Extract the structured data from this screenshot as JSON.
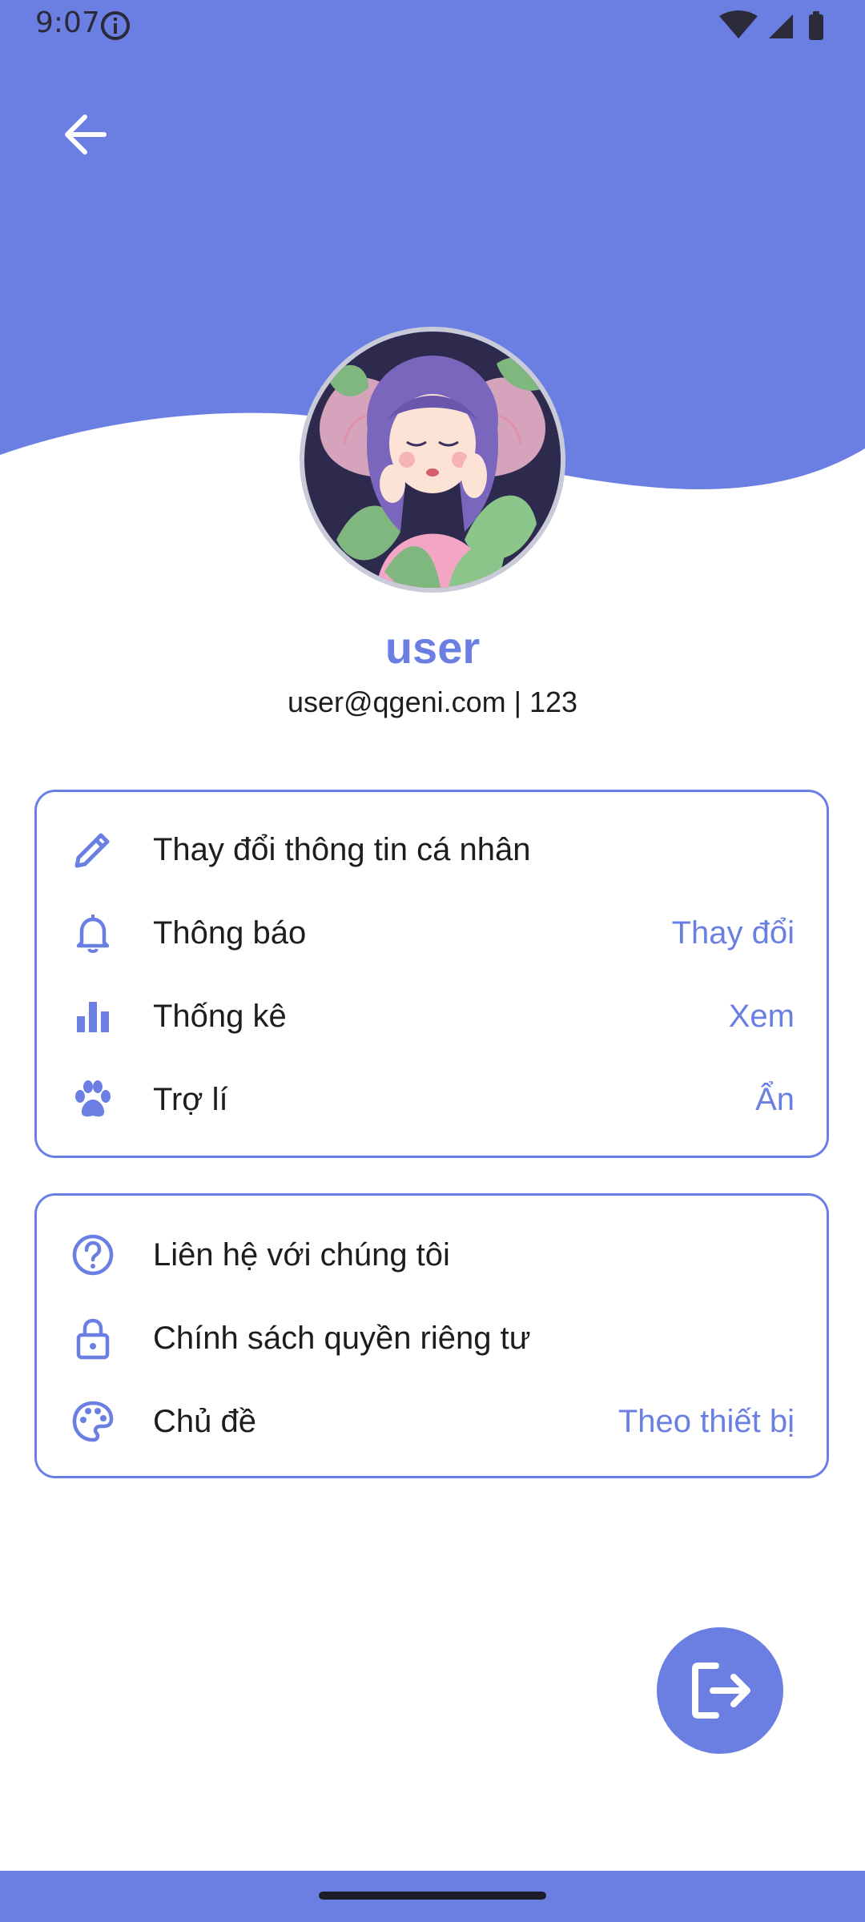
{
  "status_bar": {
    "time": "9:07"
  },
  "colors": {
    "accent": "#6b7fe3",
    "text": "#1d1d1f"
  },
  "profile": {
    "name": "user",
    "subtitle": "user@qgeni.com | 123"
  },
  "settings_card": {
    "items": [
      {
        "icon": "pencil-icon",
        "label": "Thay đổi thông tin cá nhân",
        "value": ""
      },
      {
        "icon": "bell-icon",
        "label": "Thông báo",
        "value": "Thay đổi"
      },
      {
        "icon": "bar-chart-icon",
        "label": "Thống kê",
        "value": "Xem"
      },
      {
        "icon": "paw-icon",
        "label": "Trợ lí",
        "value": "Ẩn"
      }
    ]
  },
  "support_card": {
    "items": [
      {
        "icon": "help-circle-icon",
        "label": "Liên hệ với chúng tôi",
        "value": ""
      },
      {
        "icon": "lock-icon",
        "label": "Chính sách quyền riêng tư",
        "value": ""
      },
      {
        "icon": "palette-icon",
        "label": "Chủ đề",
        "value": "Theo thiết bị"
      }
    ]
  },
  "icons": {
    "back": "arrow-left-icon",
    "logout": "logout-icon",
    "status_info": "info-icon"
  }
}
